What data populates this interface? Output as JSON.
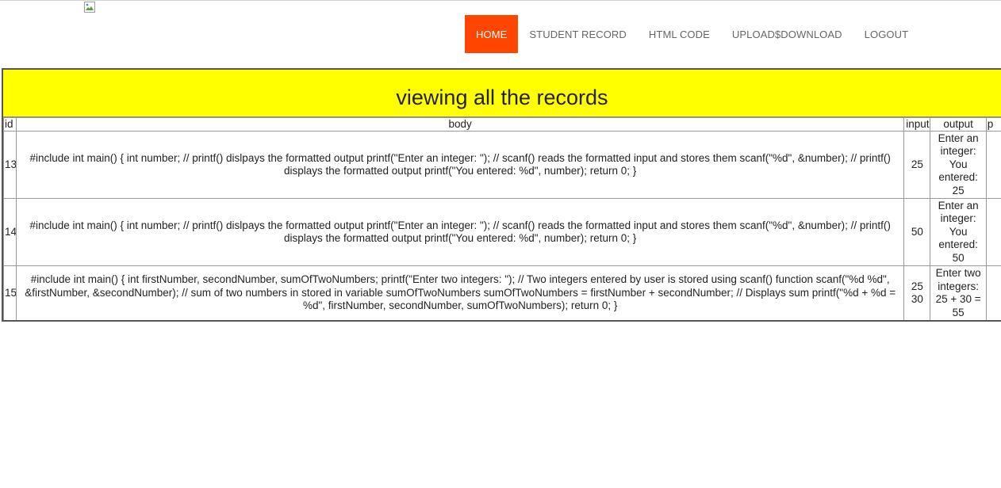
{
  "nav": {
    "items": [
      {
        "label": "HOME",
        "active": true
      },
      {
        "label": "STUDENT RECORD",
        "active": false
      },
      {
        "label": "HTML CODE",
        "active": false
      },
      {
        "label": "UPLOAD$DOWNLOAD",
        "active": false
      },
      {
        "label": "LOGOUT",
        "active": false
      }
    ]
  },
  "records": {
    "title": "viewing all the records",
    "headers": {
      "id": "id",
      "body": "body",
      "input": "input",
      "output": "output",
      "more": "p"
    },
    "rows": [
      {
        "id": "13",
        "body": "#include int main() { int number; // printf() dislpays the formatted output printf(\"Enter an integer: \"); // scanf() reads the formatted input and stores them scanf(\"%d\", &number); // printf() displays the formatted output printf(\"You entered: %d\", number); return 0; }",
        "input": "25",
        "output": "Enter an integer: You entered: 25"
      },
      {
        "id": "14",
        "body": "#include int main() { int number; // printf() dislpays the formatted output printf(\"Enter an integer: \"); // scanf() reads the formatted input and stores them scanf(\"%d\", &number); // printf() displays the formatted output printf(\"You entered: %d\", number); return 0; }",
        "input": "50",
        "output": "Enter an integer: You entered: 50"
      },
      {
        "id": "15",
        "body": "#include int main() { int firstNumber, secondNumber, sumOfTwoNumbers; printf(\"Enter two integers: \"); // Two integers entered by user is stored using scanf() function scanf(\"%d %d\", &firstNumber, &secondNumber); // sum of two numbers in stored in variable sumOfTwoNumbers sumOfTwoNumbers = firstNumber + secondNumber; // Displays sum printf(\"%d + %d = %d\", firstNumber, secondNumber, sumOfTwoNumbers); return 0; }",
        "input": "25 30",
        "output": "Enter two integers: 25 + 30 = 55"
      }
    ]
  },
  "colors": {
    "nav_active_bg": "#ff4500",
    "title_bg": "#ffff00"
  },
  "icons": {
    "logo": "broken-image-icon"
  }
}
